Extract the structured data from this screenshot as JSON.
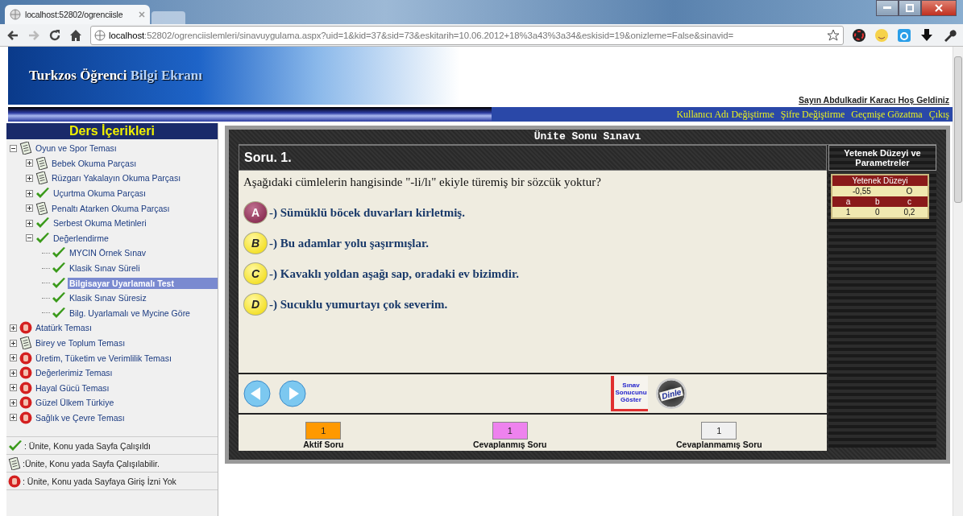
{
  "browser": {
    "tab_title": "localhost:52802/ogrenciisle",
    "url_host": "localhost",
    "url_rest": ":52802/ogrenciislemleri/sinavuygulama.aspx?uid=1&kid=37&sid=73&eskitarih=10.06.2012+18%3a43%3a34&eskisid=19&onizleme=False&sinavid="
  },
  "header": {
    "title_bold": "Turkzos Öğrenci",
    "title_light": "Bilgi Ekranı",
    "welcome": "Sayın Abdulkadir Karacı Hoş Geldiniz"
  },
  "menu": [
    "Kullanıcı Adı Değiştirme",
    "Şifre Değiştirme",
    "Geçmişe Gözatma",
    "Çıkış"
  ],
  "sidebar": {
    "title": "Ders İçerikleri",
    "tree": [
      {
        "label": "Oyun ve Spor Teması",
        "kind": "note",
        "expanded": true,
        "selected": false,
        "children": [
          {
            "label": "Bebek Okuma Parçası",
            "kind": "note",
            "expanded": false,
            "selected": false
          },
          {
            "label": "Rüzgarı Yakalayın Okuma Parçası",
            "kind": "note",
            "expanded": false,
            "selected": false
          },
          {
            "label": "Uçurtma Okuma Parçası",
            "kind": "check",
            "expanded": false,
            "selected": false
          },
          {
            "label": "Penaltı Atarken Okuma Parçası",
            "kind": "note",
            "expanded": false,
            "selected": false
          },
          {
            "label": "Serbest Okuma Metinleri",
            "kind": "check",
            "expanded": false,
            "selected": false
          },
          {
            "label": "Değerlendirme",
            "kind": "check",
            "expanded": true,
            "selected": false,
            "children": [
              {
                "label": "MYCIN Örnek Sınav",
                "kind": "check",
                "selected": false
              },
              {
                "label": "Klasik Sınav Süreli",
                "kind": "check",
                "selected": false
              },
              {
                "label": "Bilgisayar Uyarlamalı Test",
                "kind": "check",
                "selected": true
              },
              {
                "label": "Klasik Sınav Süresiz",
                "kind": "check",
                "selected": false
              },
              {
                "label": "Bilg. Uyarlamalı ve Mycine Göre",
                "kind": "check",
                "selected": false
              }
            ]
          }
        ]
      },
      {
        "label": "Atatürk Teması",
        "kind": "stop",
        "expanded": false,
        "selected": false
      },
      {
        "label": "Birey ve Toplum Teması",
        "kind": "note",
        "expanded": false,
        "selected": false
      },
      {
        "label": "Üretim, Tüketim ve Verimlilik Teması",
        "kind": "stop",
        "expanded": false,
        "selected": false
      },
      {
        "label": "Değerlerimiz Teması",
        "kind": "stop",
        "expanded": false,
        "selected": false
      },
      {
        "label": "Hayal Gücü Teması",
        "kind": "stop",
        "expanded": false,
        "selected": false
      },
      {
        "label": "Güzel Ülkem Türkiye",
        "kind": "stop",
        "expanded": false,
        "selected": false
      },
      {
        "label": "Sağlık ve Çevre Teması",
        "kind": "stop",
        "expanded": false,
        "selected": false
      }
    ],
    "legend": [
      {
        "kind": "check",
        "text": ": Ünite, Konu yada Sayfa Çalışıldı"
      },
      {
        "kind": "note",
        "text": ":Ünite, Konu yada Sayfa Çalışılabilir."
      },
      {
        "kind": "stop",
        "text": ": Ünite, Konu yada Sayfaya Giriş İzni Yok"
      }
    ]
  },
  "exam": {
    "title": "Ünite Sonu Sınavı",
    "question_no": "Soru. 1.",
    "question": "Aşağıdaki cümlelerin hangisinde \"-li/lı\" ekiyle türemiş bir sözcük yoktur?",
    "options": [
      {
        "letter": "A",
        "text": "-) Sümüklü böcek duvarları kirletmiş.",
        "selected": true
      },
      {
        "letter": "B",
        "text": "-) Bu adamlar yolu şaşırmışlar.",
        "selected": false
      },
      {
        "letter": "C",
        "text": "-) Kavaklı yoldan aşağı sap, oradaki ev bizimdir.",
        "selected": false
      },
      {
        "letter": "D",
        "text": "-) Sucuklu yumurtayı çok severim.",
        "selected": false
      }
    ],
    "result_icon_text": [
      "Sınav",
      "Sonucunu",
      "Göster"
    ],
    "listen_text": "Dinle",
    "status_legend": [
      {
        "number": "1",
        "label": "Aktif Soru",
        "color": "#ff9900"
      },
      {
        "number": "1",
        "label": "Cevaplanmış Soru",
        "color": "#ee82ee"
      },
      {
        "number": "1",
        "label": "Cevaplanmamış Soru",
        "color": "#f0f0f0"
      }
    ]
  },
  "parameters": {
    "title": "Yetenek Düzeyi ve Parametreler",
    "level_header": "Yetenek Düzeyi",
    "level_values": [
      "-0,55",
      "O"
    ],
    "param_headers": [
      "a",
      "b",
      "c"
    ],
    "param_values": [
      "1",
      "0",
      "0,2"
    ]
  }
}
